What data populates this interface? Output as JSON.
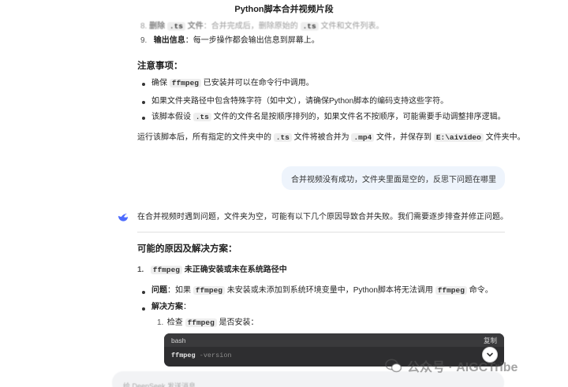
{
  "header": {
    "title": "Python脚本合并视频片段"
  },
  "step8_faded": {
    "num": "8.",
    "label": "删除",
    "code": ".ts",
    "label2": "文件",
    "text": "：合并完成后，删除原始的",
    "code2": ".ts",
    "text2": "文件和文件列表。"
  },
  "step9": {
    "num": "9.",
    "label": "输出信息",
    "text": "：每一步操作都会输出信息到屏幕上。"
  },
  "notes": {
    "heading": "注意事项：",
    "items": [
      {
        "pre": "确保",
        "code": "ffmpeg",
        "post": "已安装并可以在命令行中调用。"
      },
      {
        "pre": "如果文件夹路径中包含特殊字符（如中文），请确保Python脚本的编码支持这些字符。"
      },
      {
        "pre": "该脚本假设",
        "code": ".ts",
        "post": "文件的文件名是按顺序排列的，如果文件名不按顺序，可能需要手动调整排序逻辑。"
      }
    ]
  },
  "summary": {
    "pre": "运行该脚本后，所有指定的文件夹中的",
    "code1": ".ts",
    "mid": "文件将被合并为",
    "code2": ".mp4",
    "mid2": "文件，并保存到",
    "code3": "E:\\aivideo",
    "post": "文件夹中。"
  },
  "user_message": "合并视频没有成功，文件夹里面是空的，反思下问题在哪里",
  "assistant": {
    "intro": "在合并视频时遇到问题，文件夹为空，可能有以下几个原因导致合并失败。我们需要逐步排查并修正问题。",
    "heading": "可能的原因及解决方案：",
    "cause1": {
      "num": "1.",
      "code": "ffmpeg",
      "text": "未正确安装或未在系统路径中"
    },
    "problem": {
      "label": "问题",
      "pre": "：如果",
      "code": "ffmpeg",
      "mid": "未安装或未添加到系统环境变量中，Python脚本将无法调用",
      "code2": "ffmpeg",
      "post": "命令。"
    },
    "solution": {
      "label": "解决方案",
      "post": "："
    },
    "sub1": {
      "num": "1.",
      "pre": "检查",
      "code": "ffmpeg",
      "post": "是否安装："
    }
  },
  "code_block": {
    "lang": "bash",
    "copy": "复制",
    "cmd": "ffmpeg",
    "flag": "-version"
  },
  "input": {
    "placeholder": "给 DeepSeek 发送消息"
  },
  "watermark": {
    "text": "公众号 · AIGCTribe"
  }
}
